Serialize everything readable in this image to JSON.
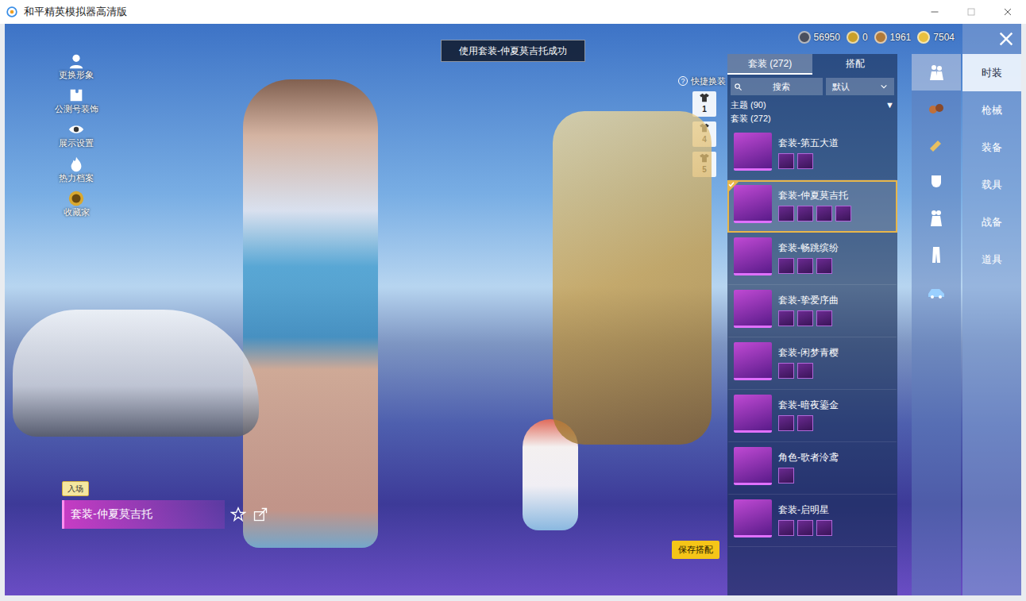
{
  "window": {
    "title": "和平精英模拟器高清版"
  },
  "toast": "使用套装-仲夏莫吉托成功",
  "currencies": [
    {
      "amount": "56950",
      "color": "#4a4f5e"
    },
    {
      "amount": "0",
      "color": "#c9a02a"
    },
    {
      "amount": "1961",
      "color": "#b07a3a"
    },
    {
      "amount": "7504",
      "color": "#e8c040"
    }
  ],
  "left_menu": [
    {
      "label": "更换形象"
    },
    {
      "label": "公测号装饰"
    },
    {
      "label": "展示设置"
    },
    {
      "label": "热力档案"
    },
    {
      "label": "收藏家"
    }
  ],
  "entrance": {
    "badge": "入场",
    "outfit": "套装-仲夏莫吉托"
  },
  "quick_change": {
    "label": "快捷换装",
    "help": "?",
    "slots": [
      {
        "number": "1"
      },
      {
        "number": "4"
      },
      {
        "number": "5"
      }
    ]
  },
  "panel": {
    "tabs": [
      {
        "label": "套装 (272)",
        "selected": true
      },
      {
        "label": "搭配",
        "selected": false
      }
    ],
    "search": {
      "label": "搜索"
    },
    "sort": {
      "label": "默认"
    },
    "filter": {
      "label": "主题 (90)",
      "arrow": "▼"
    },
    "section": "套装 (272)",
    "items": [
      {
        "name": "套装-第五大道",
        "parts": 2,
        "selected": false
      },
      {
        "name": "套装-仲夏莫吉托",
        "parts": 4,
        "selected": true
      },
      {
        "name": "套装-畅跳缤纷",
        "parts": 3,
        "selected": false
      },
      {
        "name": "套装-挚爱序曲",
        "parts": 3,
        "selected": false
      },
      {
        "name": "套装-闲梦青樱",
        "parts": 2,
        "selected": false
      },
      {
        "name": "套装-暗夜鎏金",
        "parts": 2,
        "selected": false
      },
      {
        "name": "角色-歌者泠鸢",
        "parts": 1,
        "selected": false
      },
      {
        "name": "套装-启明星",
        "parts": 3,
        "selected": false
      }
    ]
  },
  "save_button": "保存搭配",
  "category_icons": [
    {
      "selected": true
    },
    {
      "selected": false
    },
    {
      "selected": false
    },
    {
      "selected": false
    },
    {
      "selected": false
    },
    {
      "selected": false
    },
    {
      "selected": false
    }
  ],
  "categories": [
    {
      "label": "时装",
      "selected": true
    },
    {
      "label": "枪械",
      "selected": false
    },
    {
      "label": "装备",
      "selected": false
    },
    {
      "label": "载具",
      "selected": false
    },
    {
      "label": "战备",
      "selected": false
    },
    {
      "label": "道具",
      "selected": false
    }
  ]
}
